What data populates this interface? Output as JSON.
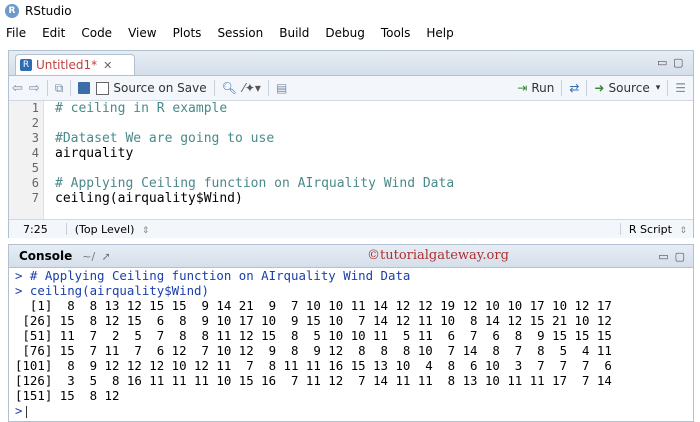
{
  "window": {
    "title": "RStudio",
    "icon": "R"
  },
  "menu": [
    "File",
    "Edit",
    "Code",
    "View",
    "Plots",
    "Session",
    "Build",
    "Debug",
    "Tools",
    "Help"
  ],
  "editor": {
    "tab_label": "Untitled1*",
    "toolbar": {
      "source_on_save": "Source on Save",
      "run": "Run",
      "source": "Source"
    },
    "lines": [
      {
        "num": "1",
        "text": "# ceiling in R example",
        "kind": "comment"
      },
      {
        "num": "2",
        "text": "",
        "kind": "code"
      },
      {
        "num": "3",
        "text": "#Dataset We are going to use",
        "kind": "comment"
      },
      {
        "num": "4",
        "text": "airquality",
        "kind": "code"
      },
      {
        "num": "5",
        "text": "",
        "kind": "code"
      },
      {
        "num": "6",
        "text": "# Applying Ceiling function on AIrquality Wind Data",
        "kind": "comment"
      },
      {
        "num": "7",
        "text": "ceiling(airquality$Wind)",
        "kind": "code"
      }
    ],
    "status": {
      "position": "7:25",
      "scope": "(Top Level)",
      "file_type": "R Script"
    }
  },
  "console": {
    "title": "Console",
    "path": "~/",
    "watermark": "©tutorialgateway.org",
    "lines": [
      {
        "text": "> # Applying Ceiling function on AIrquality Wind Data",
        "kind": "cmd"
      },
      {
        "text": "> ceiling(airquality$Wind)",
        "kind": "cmd"
      },
      {
        "text": "  [1]  8  8 13 12 15 15  9 14 21  9  7 10 10 11 14 12 12 19 12 10 10 17 10 12 17",
        "kind": "out"
      },
      {
        "text": " [26] 15  8 12 15  6  8  9 10 17 10  9 15 10  7 14 12 11 10  8 14 12 15 21 10 12",
        "kind": "out"
      },
      {
        "text": " [51] 11  7  2  5  7  8  8 11 12 15  8  5 10 10 11  5 11  6  7  6  8  9 15 15 15",
        "kind": "out"
      },
      {
        "text": " [76] 15  7 11  7  6 12  7 10 12  9  8  9 12  8  8  8 10  7 14  8  7  8  5  4 11",
        "kind": "out"
      },
      {
        "text": "[101]  8  9 12 12 12 10 12 11  7  8 11 11 16 15 13 10  4  8  6 10  3  7  7  7  6",
        "kind": "out"
      },
      {
        "text": "[126]  3  5  8 16 11 11 11 10 15 16  7 11 12  7 14 11 11  8 13 10 11 11 17  7 14",
        "kind": "out"
      },
      {
        "text": "[151] 15  8 12",
        "kind": "out"
      }
    ],
    "prompt": ">"
  }
}
